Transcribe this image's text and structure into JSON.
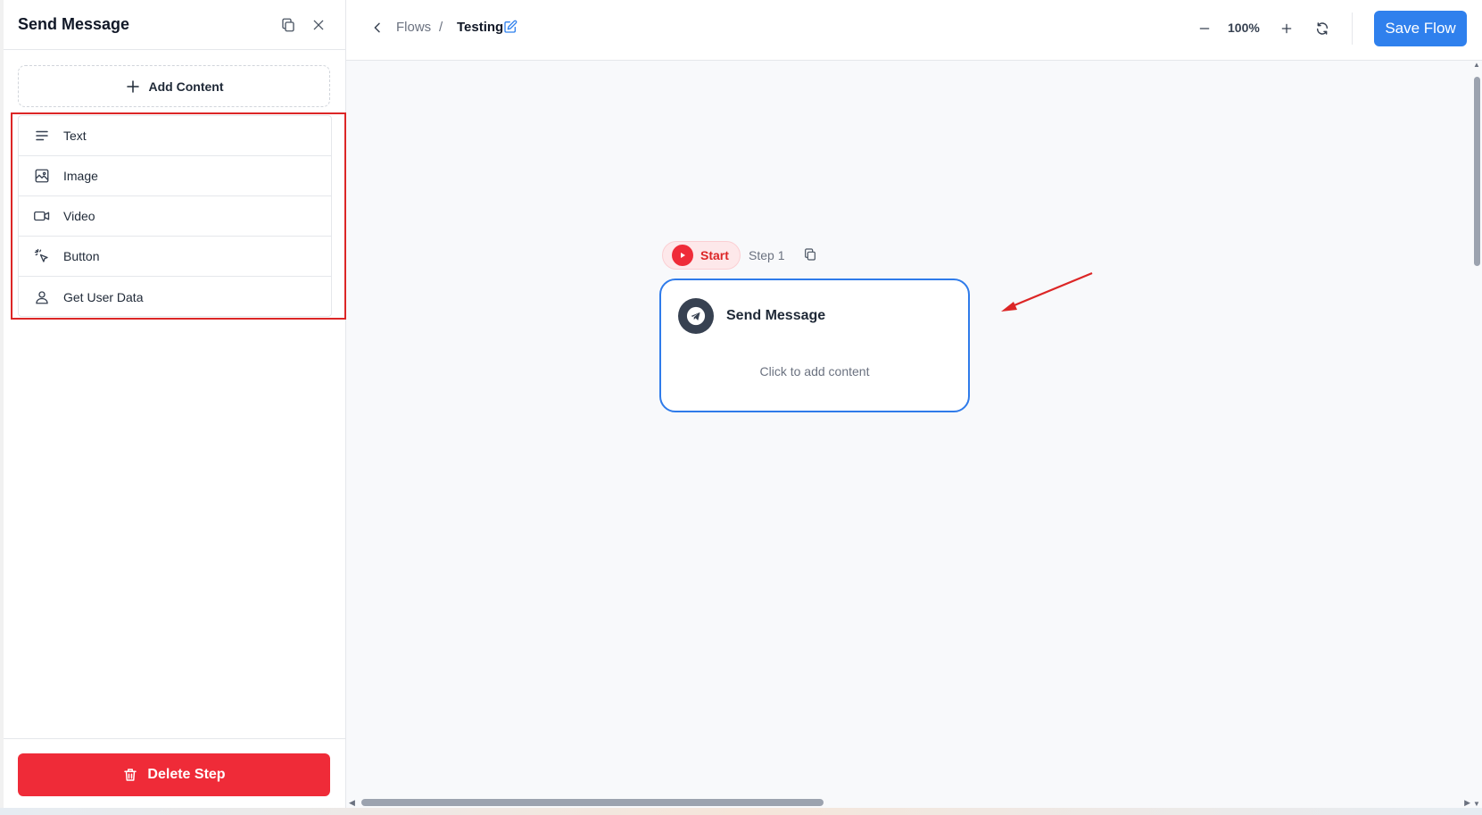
{
  "sidebar": {
    "title": "Send Message",
    "copy_icon": "copy-icon",
    "close_icon": "close-icon",
    "add_content_label": "Add Content",
    "items": [
      {
        "label": "Text",
        "icon": "text-lines-icon"
      },
      {
        "label": "Image",
        "icon": "image-icon"
      },
      {
        "label": "Video",
        "icon": "video-icon"
      },
      {
        "label": "Button",
        "icon": "cursor-click-icon"
      },
      {
        "label": "Get User Data",
        "icon": "user-icon"
      }
    ],
    "delete_label": "Delete Step",
    "delete_color": "#ef2b38",
    "highlight_color": "#dc2626"
  },
  "topbar": {
    "breadcrumb_parent": "Flows",
    "breadcrumb_separator": "/",
    "breadcrumb_current": "Testing",
    "zoom_level": "100%",
    "save_label": "Save Flow",
    "accent": "#2f80ed"
  },
  "canvas": {
    "start_label": "Start",
    "step_label": "Step 1",
    "node": {
      "title": "Send Message",
      "hint": "Click to add content",
      "icon": "telegram-send-icon"
    },
    "annotation_arrow_color": "#dc2626"
  }
}
